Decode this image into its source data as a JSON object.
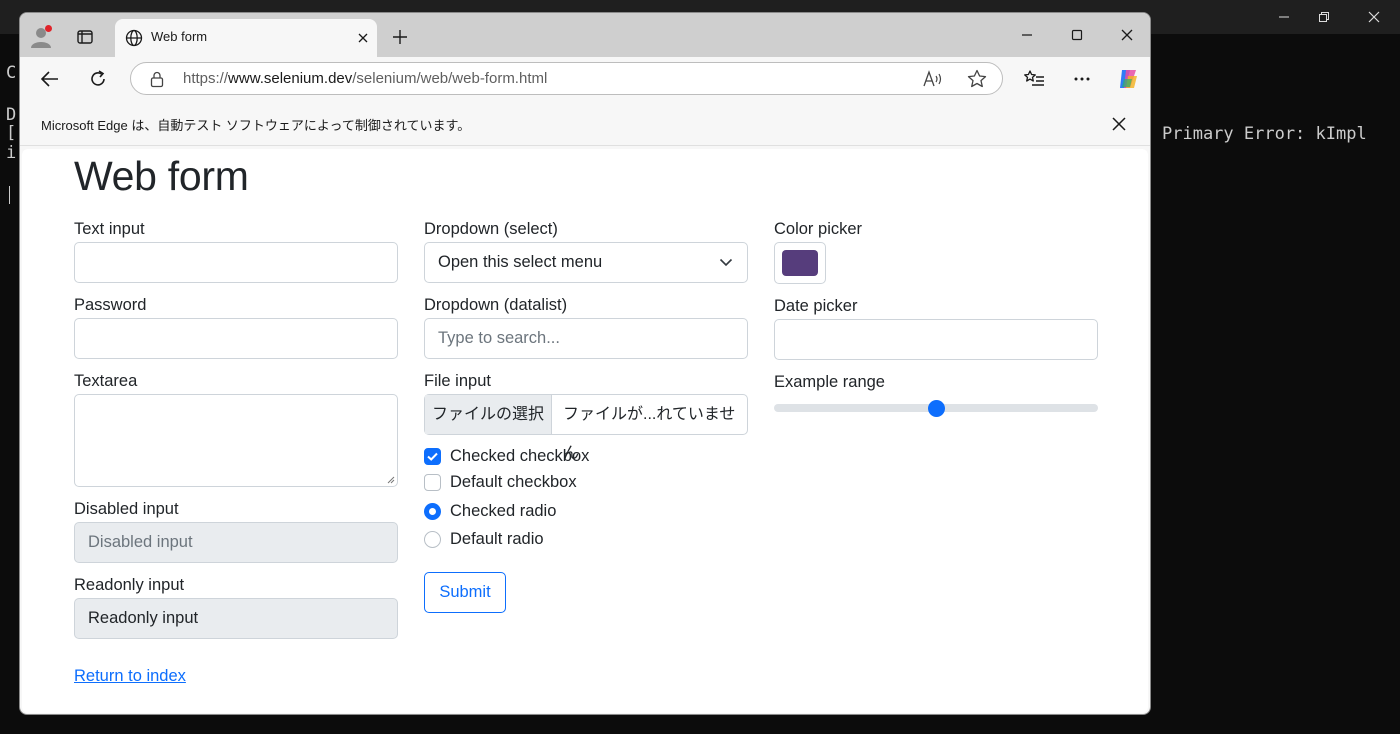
{
  "terminal": {
    "error_text": "Primary Error: kImpl",
    "left_fragments": [
      "C",
      "D",
      "[",
      "i"
    ]
  },
  "browser": {
    "tab": {
      "title": "Web form"
    },
    "url": {
      "prefix": "https://",
      "domain": "www.selenium.dev",
      "path": "/selenium/web/web-form.html"
    },
    "infobar": {
      "message": "Microsoft Edge は、自動テスト ソフトウェアによって制御されています。"
    }
  },
  "page": {
    "title": "Web form",
    "text_input": {
      "label": "Text input",
      "value": ""
    },
    "password": {
      "label": "Password",
      "value": ""
    },
    "textarea": {
      "label": "Textarea",
      "value": ""
    },
    "disabled_input": {
      "label": "Disabled input",
      "placeholder": "Disabled input"
    },
    "readonly_input": {
      "label": "Readonly input",
      "value": "Readonly input"
    },
    "dropdown_select": {
      "label": "Dropdown (select)",
      "selected": "Open this select menu"
    },
    "dropdown_datalist": {
      "label": "Dropdown (datalist)",
      "placeholder": "Type to search..."
    },
    "file_input": {
      "label": "File input",
      "button": "ファイルの選択",
      "status": "ファイルが...れていません"
    },
    "options": [
      {
        "type": "checkbox",
        "label": "Checked checkbox",
        "checked": true
      },
      {
        "type": "checkbox",
        "label": "Default checkbox",
        "checked": false
      },
      {
        "type": "radio",
        "label": "Checked radio",
        "checked": true
      },
      {
        "type": "radio",
        "label": "Default radio",
        "checked": false
      }
    ],
    "submit": "Submit",
    "color_picker": {
      "label": "Color picker",
      "value": "#563d7c"
    },
    "date_picker": {
      "label": "Date picker",
      "value": ""
    },
    "range": {
      "label": "Example range",
      "value": 50,
      "min": 0,
      "max": 100
    },
    "return_link": "Return to index"
  }
}
